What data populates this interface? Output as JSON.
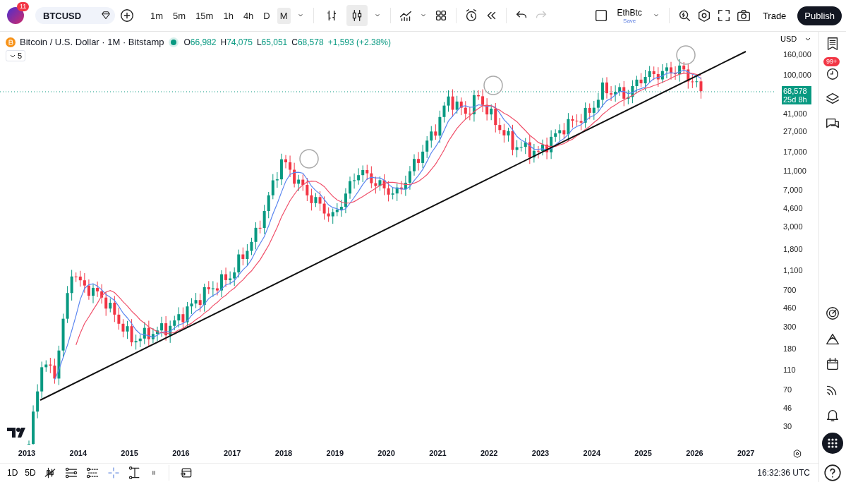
{
  "toolbar": {
    "avatar_badge": "11",
    "symbol": "BTCUSD",
    "timeframes": [
      {
        "label": "1m",
        "selected": false
      },
      {
        "label": "5m",
        "selected": false
      },
      {
        "label": "15m",
        "selected": false
      },
      {
        "label": "1h",
        "selected": false
      },
      {
        "label": "4h",
        "selected": false
      },
      {
        "label": "D",
        "selected": false
      },
      {
        "label": "M",
        "selected": true
      }
    ],
    "chart_types": [
      {
        "kind": "bars",
        "selected": false
      },
      {
        "kind": "candles",
        "selected": true
      }
    ],
    "redo": {
      "disabled": true
    },
    "layout": {
      "name": "EthBtc",
      "status": "Save"
    },
    "trade": "Trade",
    "publish": "Publish"
  },
  "legend": {
    "title": "Bitcoin / U.S. Dollar · 1M · Bitstamp",
    "ohlc": [
      {
        "key": "O",
        "value": "66,982"
      },
      {
        "key": "H",
        "value": "74,075"
      },
      {
        "key": "L",
        "value": "65,051"
      },
      {
        "key": "C",
        "value": "68,578"
      }
    ],
    "change": "+1,593 (+2.38%)",
    "indicators_count": "5"
  },
  "price_axis": {
    "currency": "USD",
    "labels": [
      "160,000",
      "100,000",
      "41,000",
      "27,000",
      "17,000",
      "11,000",
      "7,000",
      "4,600",
      "3,000",
      "1,800",
      "1,100",
      "700",
      "460",
      "300",
      "180",
      "110",
      "70",
      "46",
      "30"
    ],
    "last_price": "68,578",
    "countdown": "25d 8h"
  },
  "time_axis": {
    "labels": [
      "2013",
      "2014",
      "2015",
      "2016",
      "2017",
      "2018",
      "2019",
      "2020",
      "2021",
      "2022",
      "2023",
      "2024",
      "2025",
      "2026",
      "2027"
    ]
  },
  "sidebar": {
    "alerts_badge": "99+"
  },
  "bottom_bar": {
    "ranges": [
      "1D",
      "5D"
    ],
    "clock": "16:32:36 UTC"
  }
}
